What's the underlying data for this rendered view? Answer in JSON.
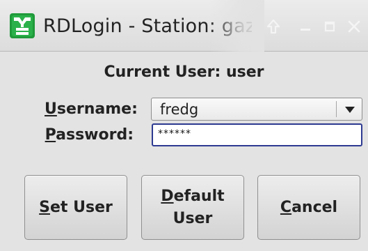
{
  "window": {
    "title": "RDLogin - Station: gaz",
    "app_icon": "rdlogin-app-icon",
    "controls": [
      "shade-up-icon",
      "minimize-icon",
      "maximize-icon",
      "close-icon"
    ]
  },
  "header": {
    "current_user_label": "Current User: user"
  },
  "form": {
    "username": {
      "mnemonic": "U",
      "label_rest": "sername:",
      "value": "fredg"
    },
    "password": {
      "mnemonic": "P",
      "label_rest": "assword:",
      "masked_value": "******"
    }
  },
  "buttons": {
    "set_user": {
      "mnemonic": "S",
      "rest": "et User"
    },
    "default_user": {
      "mnemonic": "D",
      "line1_rest": "efault",
      "line2": "User"
    },
    "cancel": {
      "mnemonic": "C",
      "rest": "ancel"
    }
  },
  "colors": {
    "background": "#e3e3e3",
    "focus_border": "#2d3a91",
    "icon_green": "#1f9a3a"
  }
}
